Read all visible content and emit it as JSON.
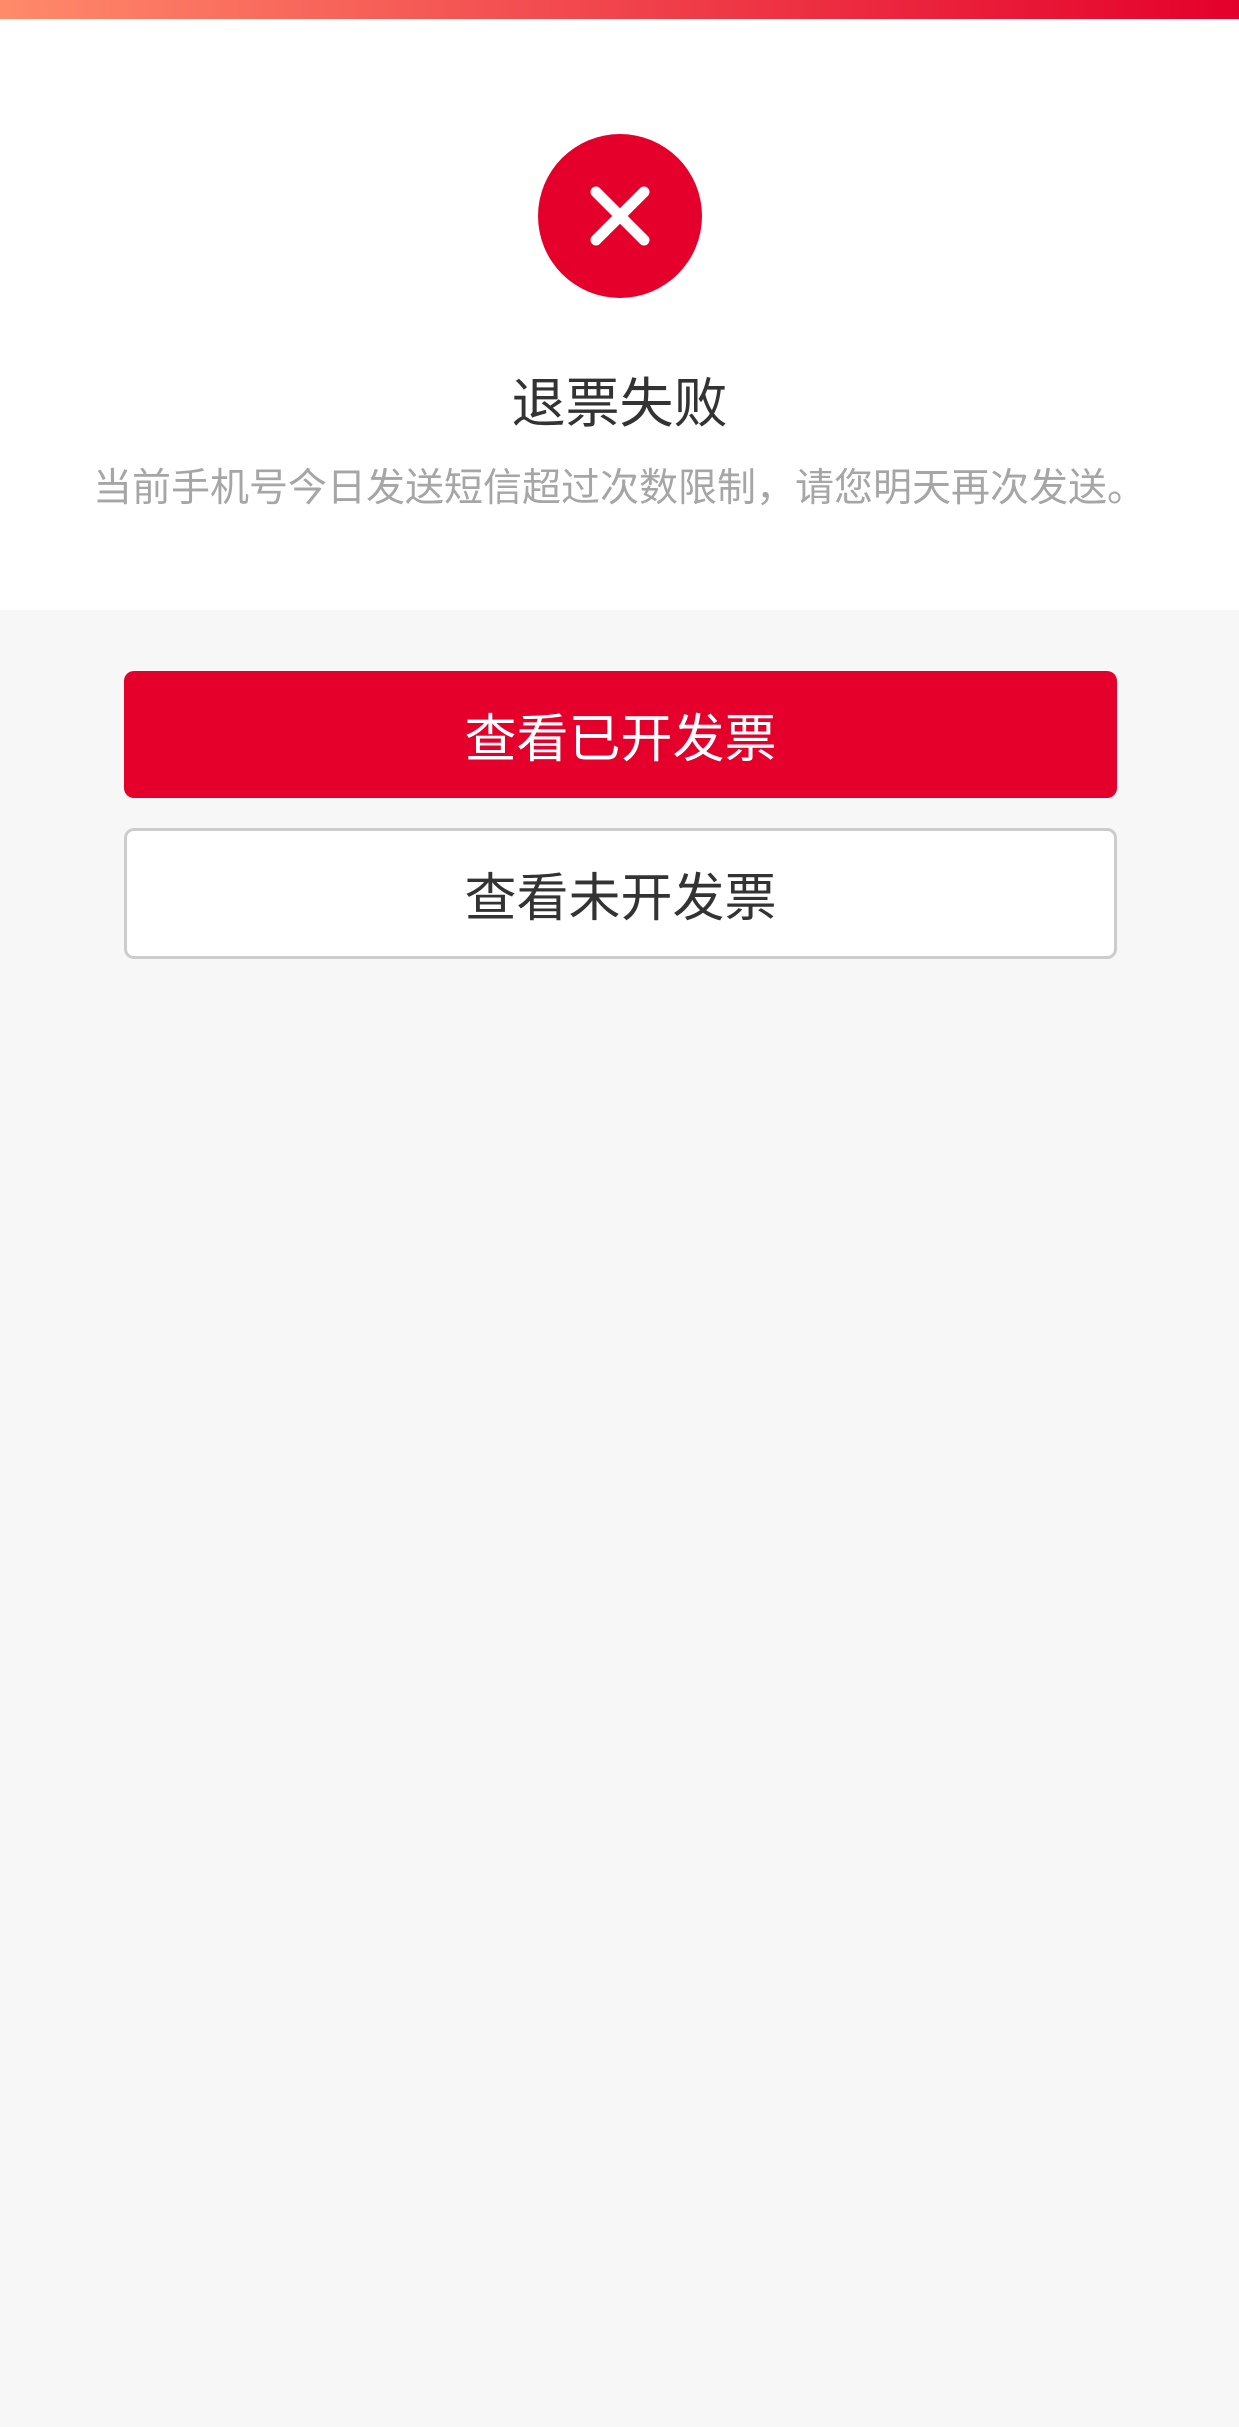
{
  "result": {
    "icon": "close-icon",
    "title": "退票失败",
    "message": "当前手机号今日发送短信超过次数限制，请您明天再次发送。"
  },
  "actions": {
    "view_issued_label": "查看已开发票",
    "view_unissued_label": "查看未开发票"
  },
  "colors": {
    "accent": "#e4002b",
    "gradient_start": "#ff8a6a",
    "background": "#f7f7f7",
    "title_text": "#333333",
    "message_text": "#a6a6a6",
    "button_border": "#cccccc"
  }
}
